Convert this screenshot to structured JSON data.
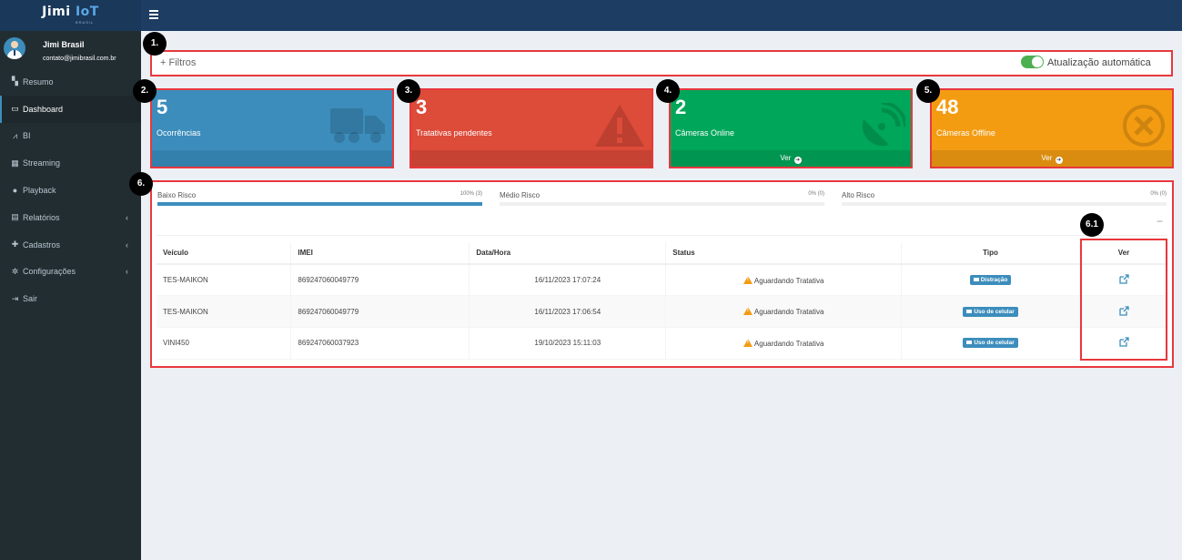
{
  "header": {
    "brand_main": "Jimi",
    "brand_accent": "IoT",
    "brand_sub": "BRASIL"
  },
  "user": {
    "name": "Jimi Brasil",
    "email": "contato@jimibrasil.com.br"
  },
  "sidebar": {
    "items": [
      {
        "label": "Resumo",
        "icon": "map-icon"
      },
      {
        "label": "Dashboard",
        "icon": "monitor-icon",
        "active": true
      },
      {
        "label": "BI",
        "icon": "chart-icon"
      },
      {
        "label": "Streaming",
        "icon": "film-icon"
      },
      {
        "label": "Playback",
        "icon": "play-circle-icon"
      },
      {
        "label": "Relatórios",
        "icon": "file-icon",
        "has_submenu": true
      },
      {
        "label": "Cadastros",
        "icon": "plus-icon",
        "has_submenu": true
      },
      {
        "label": "Configurações",
        "icon": "cogs-icon",
        "has_submenu": true
      },
      {
        "label": "Sair",
        "icon": "sign-out-icon"
      }
    ]
  },
  "filters": {
    "label": "+ Filtros",
    "auto_update_label": "Atualização automática",
    "auto_update_on": true
  },
  "badges": {
    "b1": "1.",
    "b2": "2.",
    "b3": "3.",
    "b4": "4.",
    "b5": "5.",
    "b6": "6.",
    "b61": "6.1"
  },
  "cards": {
    "ocorrencias": {
      "value": "5",
      "label": "Ocorrências",
      "color": "#3c8dbc"
    },
    "tratativas": {
      "value": "3",
      "label": "Tratativas pendentes",
      "color": "#dd4b39"
    },
    "online": {
      "value": "2",
      "label": "Câmeras Online",
      "footer": "Ver",
      "color": "#00a65a"
    },
    "offline": {
      "value": "48",
      "label": "Câmeras Offline",
      "footer": "Ver",
      "color": "#f39c12"
    }
  },
  "risk": [
    {
      "label": "Baixo Risco",
      "value": "100% (3)",
      "percent": 100
    },
    {
      "label": "Médio Risco",
      "value": "0% (0)",
      "percent": 0
    },
    {
      "label": "Alto Risco",
      "value": "0% (0)",
      "percent": 0
    }
  ],
  "collapse_label": "−",
  "table": {
    "headers": [
      "Veículo",
      "IMEI",
      "Data/Hora",
      "Status",
      "Tipo",
      "Ver"
    ],
    "rows": [
      {
        "veiculo": "TES-MAIKON",
        "imei": "869247060049779",
        "data": "16/11/2023 17:07:24",
        "status": "Aguardando Tratativa",
        "tipo": "Distração"
      },
      {
        "veiculo": "TES-MAIKON",
        "imei": "869247060049779",
        "data": "16/11/2023 17:06:54",
        "status": "Aguardando Tratativa",
        "tipo": "Uso de celular"
      },
      {
        "veiculo": "VINI450",
        "imei": "869247060037923",
        "data": "19/10/2023 15:11:03",
        "status": "Aguardando Tratativa",
        "tipo": "Uso de celular"
      }
    ]
  }
}
